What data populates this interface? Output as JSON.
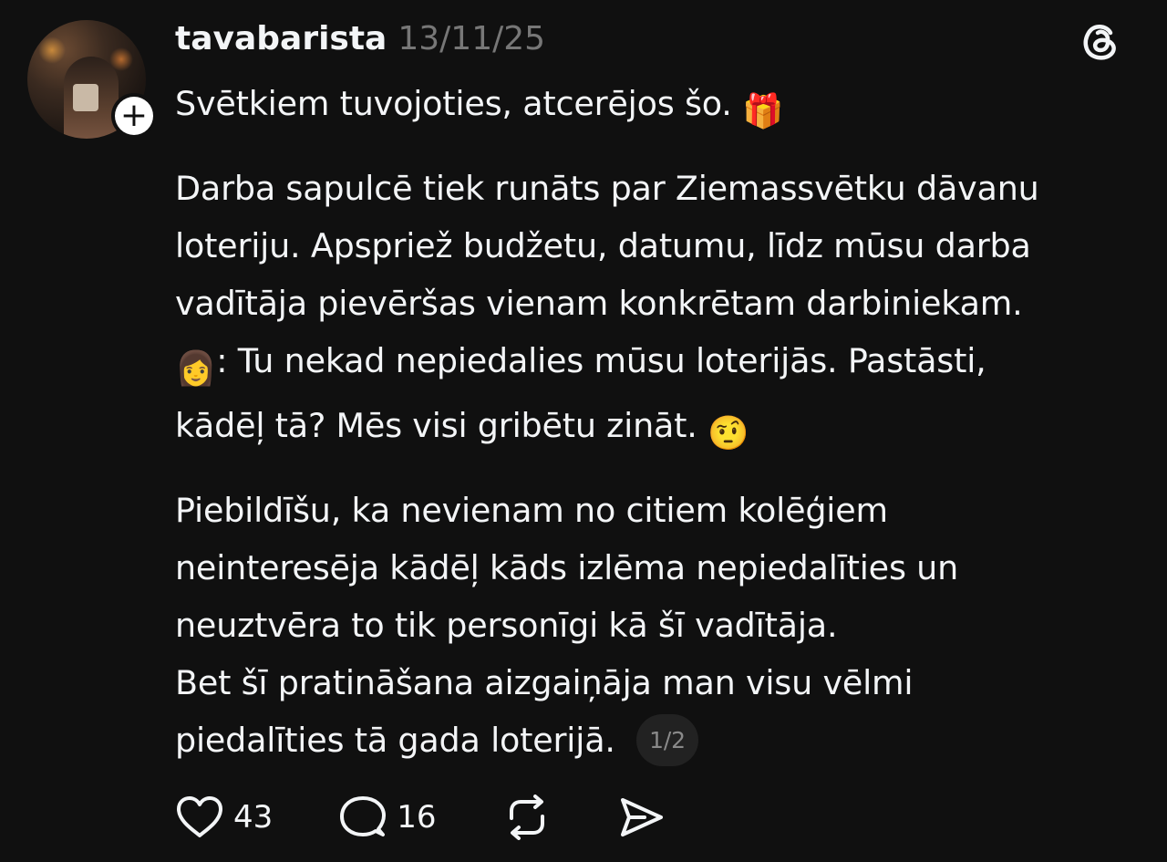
{
  "post": {
    "username": "tavabarista",
    "timestamp": "13/11/25",
    "lines": {
      "l1": "Svētkiem tuvojoties, atcerējos šo.",
      "p2_1": "Darba sapulcē tiek runāts par Ziemassvētku dāvanu",
      "p2_2": "loteriju. Apspriež budžetu, datumu, līdz mūsu darba",
      "p2_3": "vadītāja pievēršas vienam konkrētam darbiniekam.",
      "p2_4": ": Tu nekad nepiedalies mūsu loterijās. Pastāsti,",
      "p2_5": "kādēļ tā? Mēs visi gribētu zināt.",
      "p3_1": "Piebildīšu, ka nevienam no citiem kolēģiem",
      "p3_2": "neinteresēja kādēļ kāds izlēma nepiedalīties un",
      "p3_3": "neuztvēra to tik personīgi kā šī vadītāja.",
      "p3_4": "Bet šī pratināšana aizgaiņāja man visu vēlmi",
      "p3_5": "piedalīties tā gada loterijā."
    },
    "emojis": {
      "gift": "🎁",
      "woman": "👩",
      "raised_eyebrow": "🤨"
    },
    "pager": "1/2"
  },
  "actions": {
    "likes": "43",
    "replies": "16"
  },
  "icons": {
    "like": "heart-icon",
    "reply": "comment-icon",
    "repost": "repost-icon",
    "share": "send-icon",
    "brand": "threads-logo-icon",
    "follow": "plus-icon"
  },
  "colors": {
    "background": "#101010",
    "text": "#f3f5f7",
    "muted": "#777777"
  }
}
